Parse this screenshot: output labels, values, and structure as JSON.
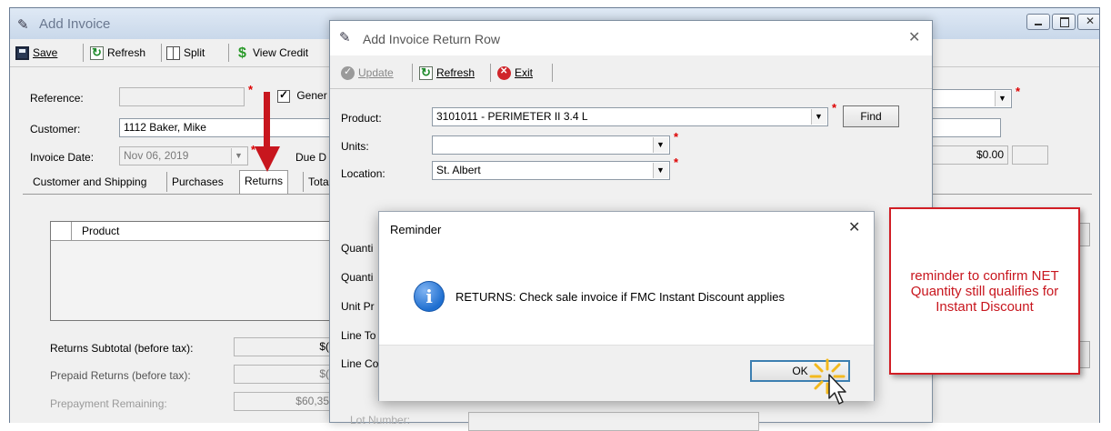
{
  "main_window": {
    "title": "Add Invoice",
    "toolbar": {
      "save": "Save",
      "refresh": "Refresh",
      "split": "Split",
      "view_credit": "View Credit"
    },
    "reference_label": "Reference:",
    "reference_value": "",
    "generate_label": "Gener",
    "customer_label": "Customer:",
    "customer_value": "1112 Baker, Mike",
    "invoice_date_label": "Invoice Date:",
    "invoice_date_value": "Nov 06, 2019",
    "due_date_label": "Due D",
    "amount_value": "$0.00",
    "tabs": [
      "Customer and Shipping",
      "Purchases",
      "Returns",
      "Tota"
    ],
    "active_tab": "Returns",
    "grid_header_product": "Product",
    "returns_subtotal_label": "Returns Subtotal (before tax):",
    "returns_subtotal_value": "$(",
    "prepaid_returns_label": "Prepaid Returns (before tax):",
    "prepaid_returns_value": "$(",
    "prepayment_remaining_label": "Prepayment Remaining:",
    "prepayment_remaining_value": "$60,35"
  },
  "return_dialog": {
    "title": "Add Invoice Return Row",
    "toolbar": {
      "update": "Update",
      "refresh": "Refresh",
      "exit": "Exit"
    },
    "product_label": "Product:",
    "product_value": "3101011 - PERIMETER II 3.4 L",
    "find_button": "Find",
    "units_label": "Units:",
    "units_value": "",
    "location_label": "Location:",
    "location_value": "St. Albert",
    "truncated_labels": [
      "Quanti",
      "Quanti",
      "Unit Pr",
      "Line To",
      "Line Co"
    ],
    "lot_number_label": "Lot Number:"
  },
  "reminder": {
    "title": "Reminder",
    "message": "RETURNS: Check sale invoice if FMC Instant Discount applies",
    "ok_button": "OK"
  },
  "callout": {
    "text": "reminder to confirm NET Quantity still qualifies for Instant Discount",
    "color": "#d11e25"
  },
  "colors": {
    "arrow": "#c8161e",
    "info_icon": "#1f6fd0"
  }
}
